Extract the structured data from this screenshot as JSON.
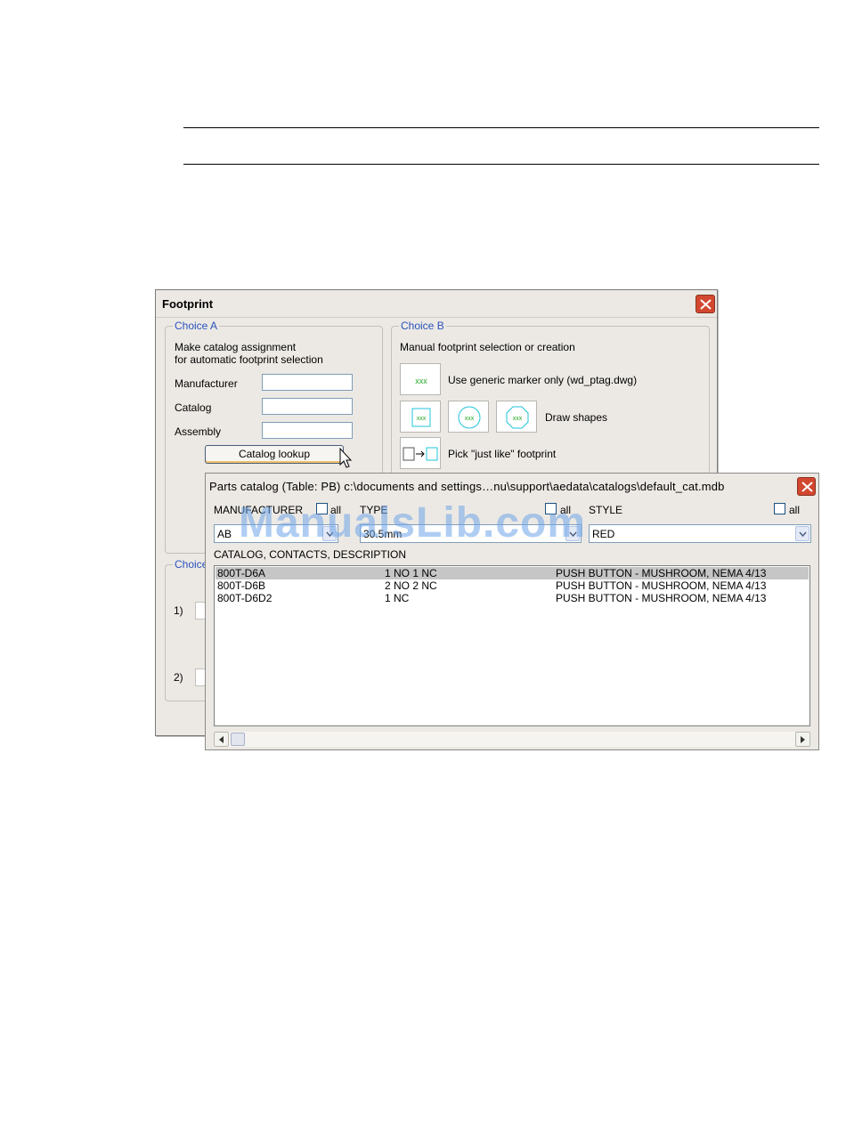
{
  "footprint": {
    "title": "Footprint",
    "choice_a": {
      "label": "Choice A",
      "desc_line1": "Make catalog assignment",
      "desc_line2": "for automatic footprint selection",
      "manufacturer_label": "Manufacturer",
      "catalog_label": "Catalog",
      "assembly_label": "Assembly",
      "manufacturer_value": "",
      "catalog_value": "",
      "assembly_value": "",
      "catalog_lookup_button": "Catalog lookup"
    },
    "choice_b": {
      "label": "Choice B",
      "desc": "Manual footprint selection or creation",
      "generic_marker": "Use generic marker only (wd_ptag.dwg)",
      "draw_shapes": "Draw shapes",
      "pick_just_like": "Pick \"just like\" footprint",
      "marker_text": "xxx"
    },
    "choice_c": {
      "label": "Choice",
      "item1": "1)",
      "item2": "2)"
    }
  },
  "parts_catalog": {
    "title": "Parts catalog (Table: PB) c:\\documents and settings…nu\\support\\aedata\\catalogs\\default_cat.mdb",
    "manufacturer_label": "MANUFACTURER",
    "type_label": "TYPE",
    "style_label": "STYLE",
    "all_label": "all",
    "manufacturer_value": "AB",
    "type_value": "30.5mm",
    "style_value": "RED",
    "list_header": "CATALOG, CONTACTS, DESCRIPTION",
    "rows": [
      {
        "catalog": "800T-D6A",
        "contacts": "1 NO 1 NC",
        "description": "PUSH BUTTON - MUSHROOM, NEMA 4/13"
      },
      {
        "catalog": "800T-D6B",
        "contacts": "2 NO 2 NC",
        "description": "PUSH BUTTON - MUSHROOM, NEMA 4/13"
      },
      {
        "catalog": "800T-D6D2",
        "contacts": "1 NC",
        "description": "PUSH BUTTON - MUSHROOM, NEMA 4/13"
      }
    ]
  },
  "watermark": "ManualsLib.com",
  "colors": {
    "group_label": "#2a52be",
    "marker_green": "#22aa22",
    "shape_cyan": "#21c4d8",
    "close_red": "#d2472f"
  }
}
